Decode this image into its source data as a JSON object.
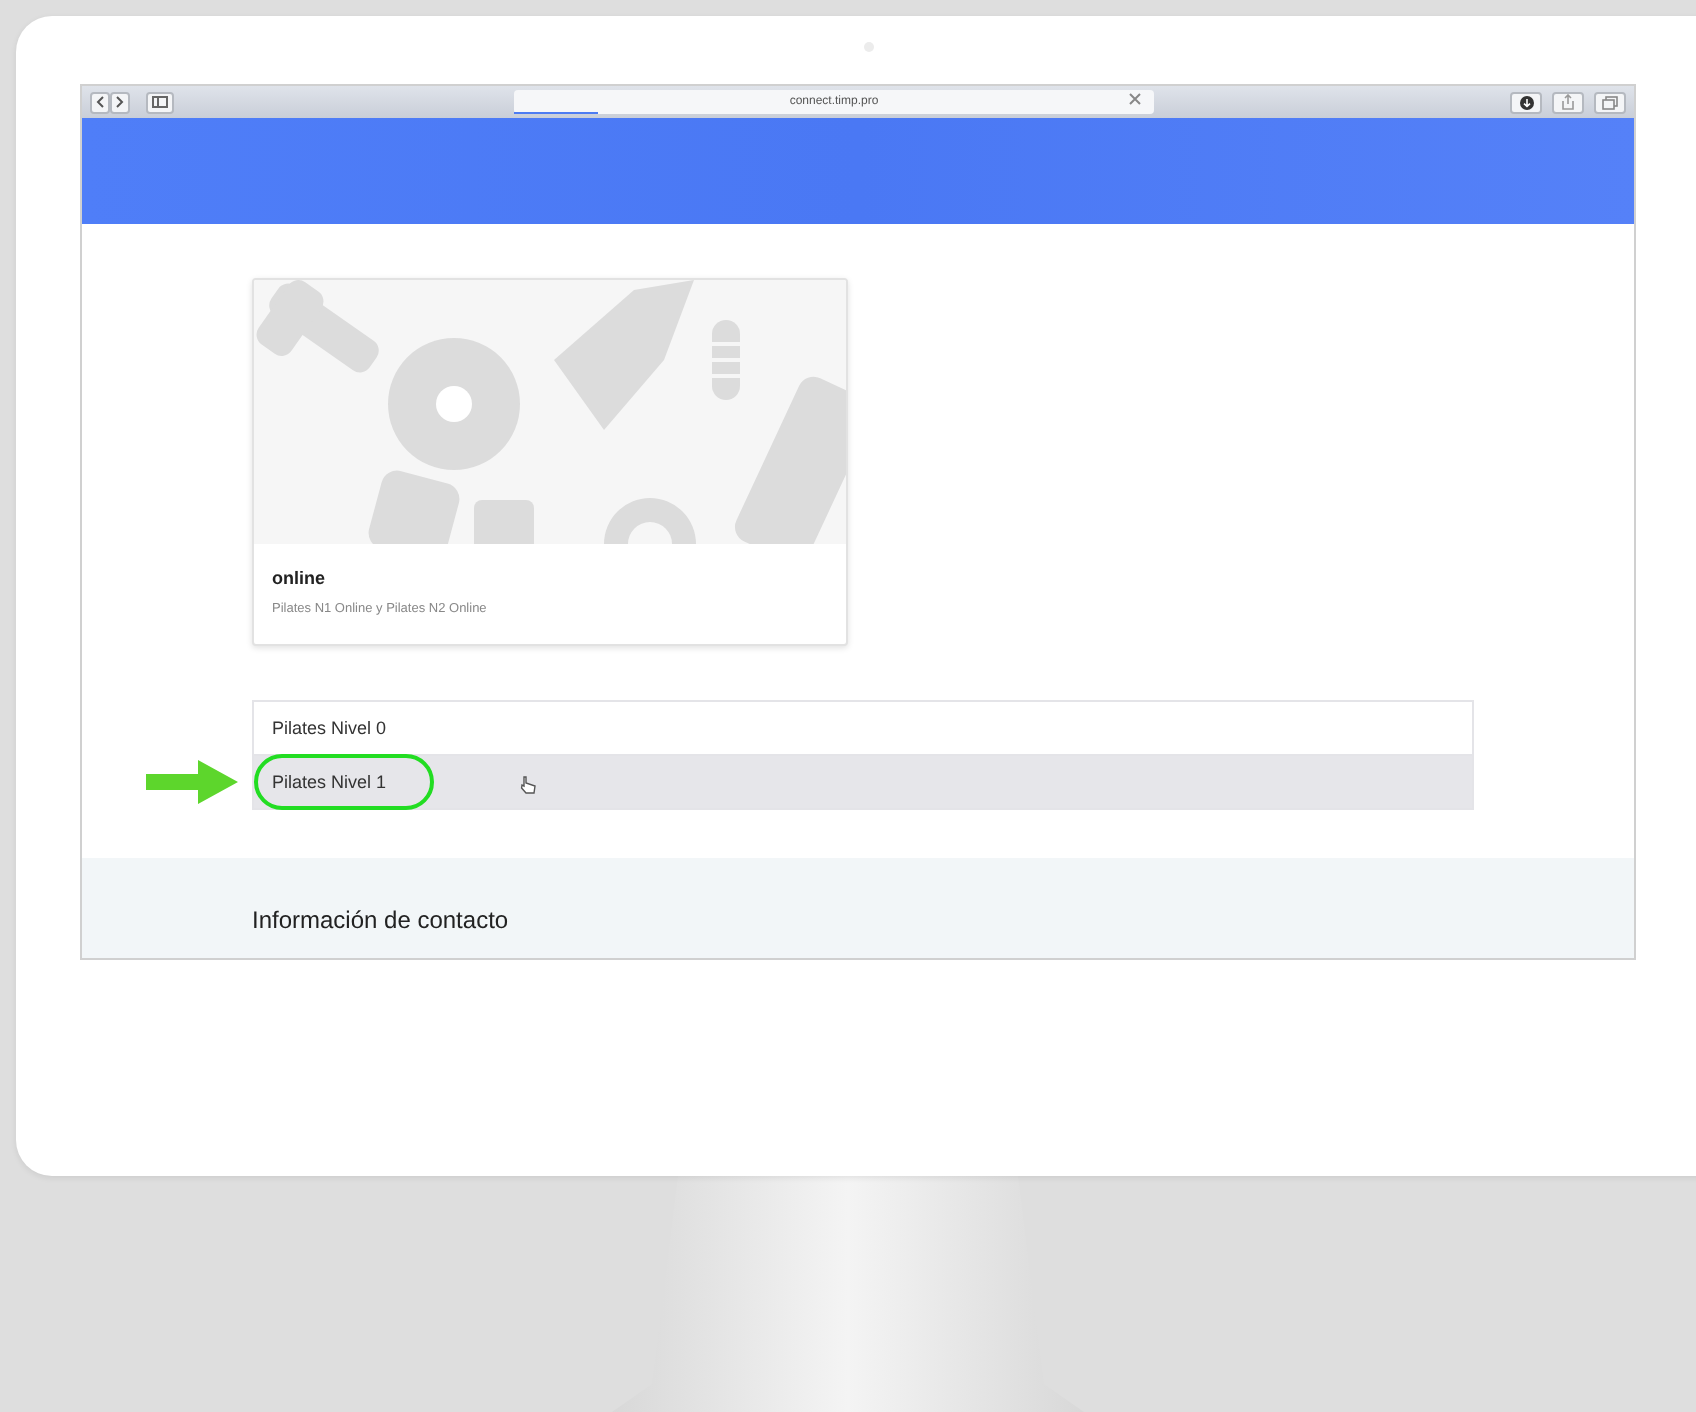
{
  "browser": {
    "url": "connect.timp.pro",
    "loading": {
      "level": 0.13
    }
  },
  "card": {
    "title": "online",
    "subtitle": "Pilates N1 Online y Pilates N2 Online"
  },
  "levels": [
    {
      "label": "Pilates Nivel 0",
      "selected": false
    },
    {
      "label": "Pilates Nivel 1",
      "selected": true
    }
  ],
  "section_title": "Información de contacto"
}
